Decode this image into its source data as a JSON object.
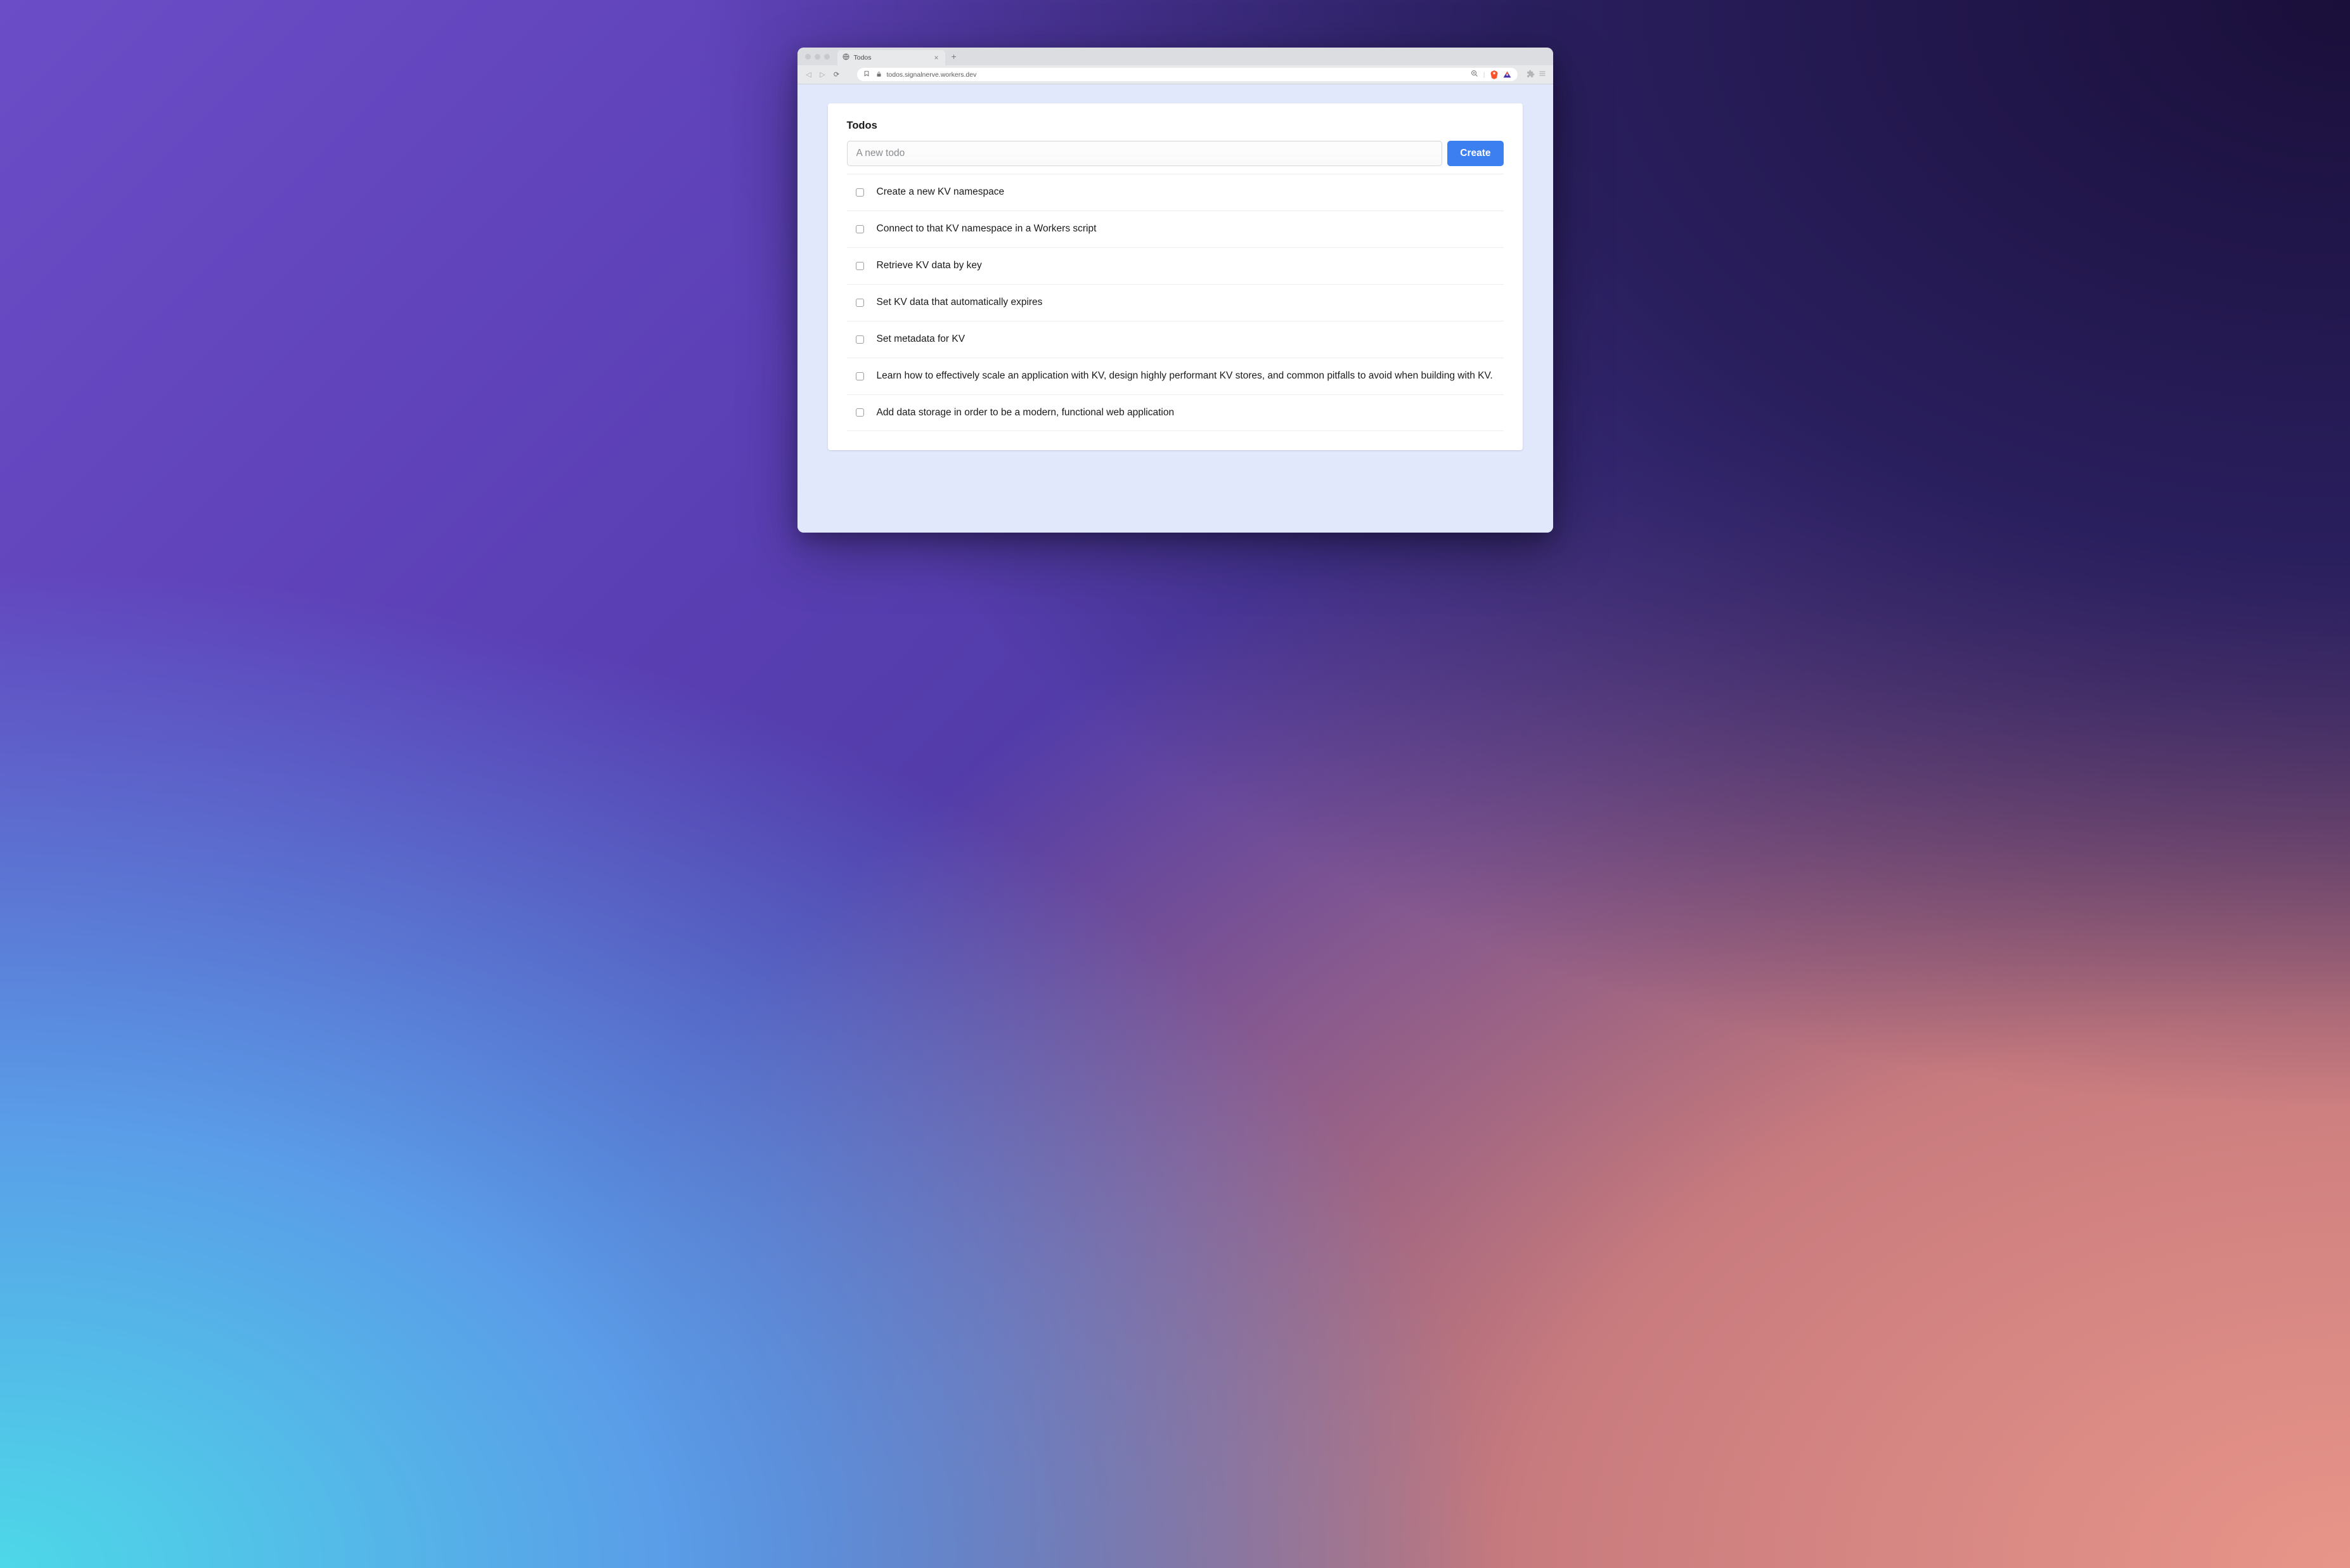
{
  "browser": {
    "tab_title": "Todos",
    "url": "todos.signalnerve.workers.dev"
  },
  "app": {
    "heading": "Todos",
    "input_placeholder": "A new todo",
    "create_button": "Create",
    "todos": [
      {
        "checked": false,
        "text": "Create a new KV namespace"
      },
      {
        "checked": false,
        "text": "Connect to that KV namespace in a Workers script"
      },
      {
        "checked": false,
        "text": "Retrieve KV data by key"
      },
      {
        "checked": false,
        "text": "Set KV data that automatically expires"
      },
      {
        "checked": false,
        "text": "Set metadata for KV"
      },
      {
        "checked": false,
        "text": "Learn how to effectively scale an application with KV, design highly performant KV stores, and common pitfalls to avoid when building with KV."
      },
      {
        "checked": false,
        "text": "Add data storage in order to be a modern, functional web application"
      }
    ]
  }
}
